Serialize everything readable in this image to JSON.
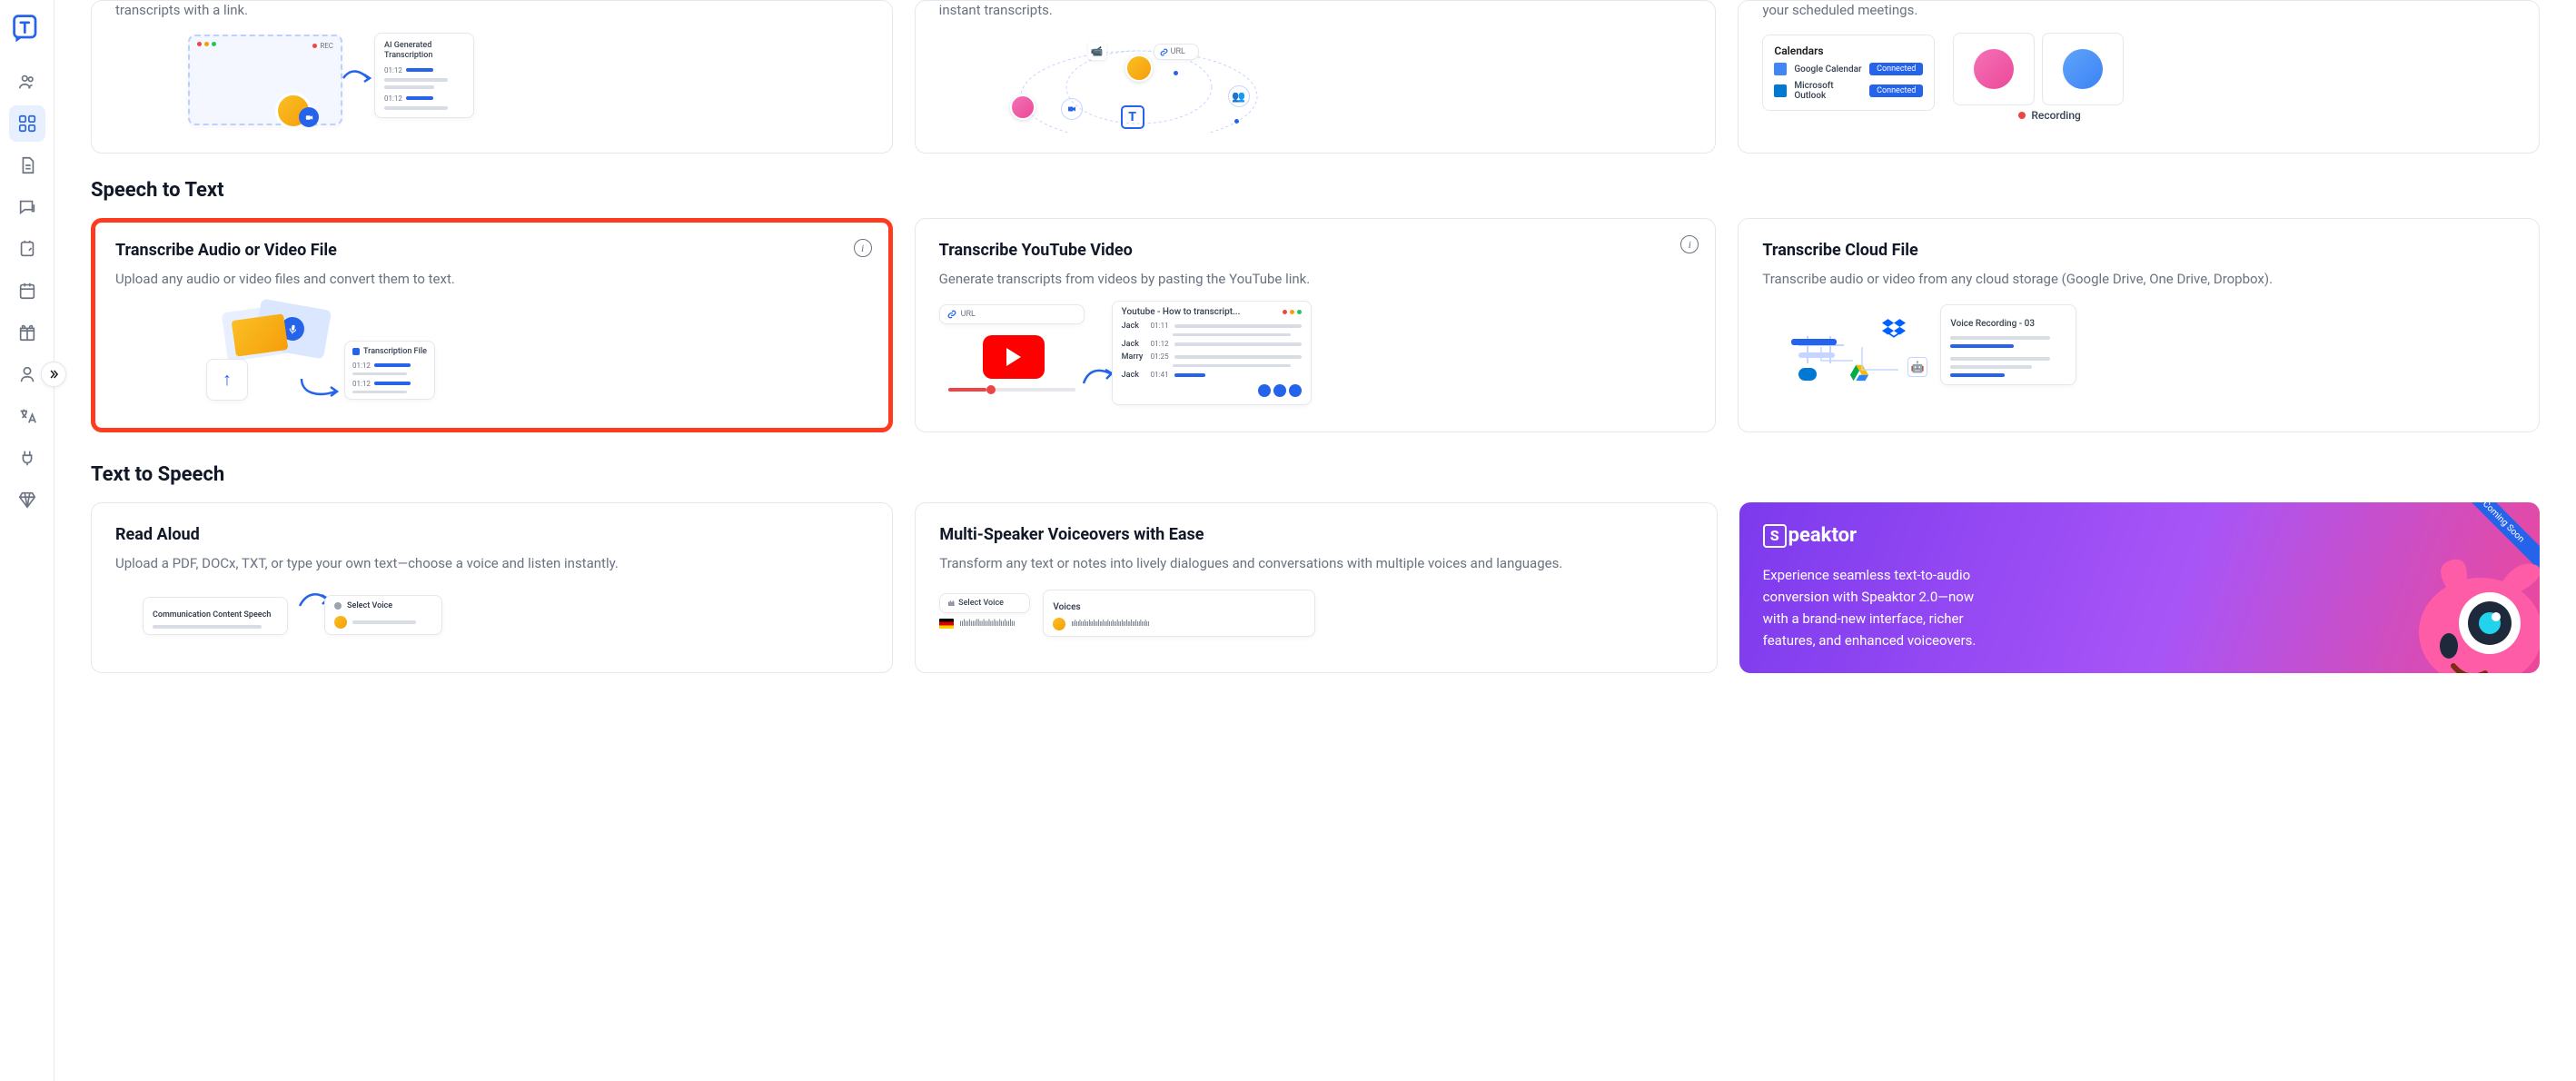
{
  "sidebar": {
    "items": [
      "people",
      "dashboard",
      "document",
      "chat",
      "notes",
      "calendar",
      "gift",
      "profile",
      "translate",
      "plugin",
      "diamond"
    ]
  },
  "top_cards": [
    {
      "desc_suffix": "transcripts with a link.",
      "illus": "meeting"
    },
    {
      "desc_suffix": "instant transcripts.",
      "illus": "network"
    },
    {
      "desc_suffix": "your scheduled meetings.",
      "illus": "calendars"
    }
  ],
  "calendars_panel": {
    "title": "Calendars",
    "google": "Google Calendar",
    "outlook": "Microsoft Outlook",
    "connected": "Connected",
    "recording": "Recording"
  },
  "sections": {
    "stt": "Speech to Text",
    "tts": "Text to Speech"
  },
  "stt_cards": [
    {
      "title": "Transcribe Audio or Video File",
      "desc": "Upload any audio or video files and convert them to text.",
      "has_info": true,
      "highlighted": true,
      "illus": "upload",
      "transcription_file_label": "Transcription File",
      "time1": "01:12",
      "time2": "01:12"
    },
    {
      "title": "Transcribe YouTube Video",
      "desc": "Generate transcripts from videos by pasting the YouTube link.",
      "has_info": true,
      "illus": "youtube",
      "url_label": "URL",
      "transcript_title": "Youtube - How to transcript...",
      "rows": [
        {
          "name": "Jack",
          "time": "01:11"
        },
        {
          "name": "Jack",
          "time": "01:12"
        },
        {
          "name": "Marry",
          "time": "01:25"
        },
        {
          "name": "Jack",
          "time": "01:41"
        }
      ]
    },
    {
      "title": "Transcribe Cloud File",
      "desc": "Transcribe audio or video from any cloud storage (Google Drive, One Drive, Dropbox).",
      "has_info": false,
      "illus": "cloud",
      "recording_label": "Voice Recording - 03"
    }
  ],
  "tts_cards": [
    {
      "title": "Read Aloud",
      "desc": "Upload a PDF, DOCx, TXT, or type your own text—choose a voice and listen instantly.",
      "comm_label": "Communication Content Speech",
      "select_voice": "Select Voice"
    },
    {
      "title": "Multi-Speaker Voiceovers with Ease",
      "desc": "Transform any text or notes into lively dialogues and conversations with multiple voices and languages.",
      "select_voice": "Select Voice",
      "voices_label": "Voices"
    }
  ],
  "promo": {
    "brand": "peaktor",
    "text": "Experience seamless text-to-audio conversion with Speaktor 2.0—now with a brand-new interface, richer features, and enhanced voiceovers.",
    "badge": "Coming Soon"
  },
  "meeting_illus": {
    "rec": "REC",
    "aigen": "AI Generated Transcription",
    "t1": "01:12",
    "t2": "01:12"
  },
  "network_illus": {
    "url": "URL"
  }
}
